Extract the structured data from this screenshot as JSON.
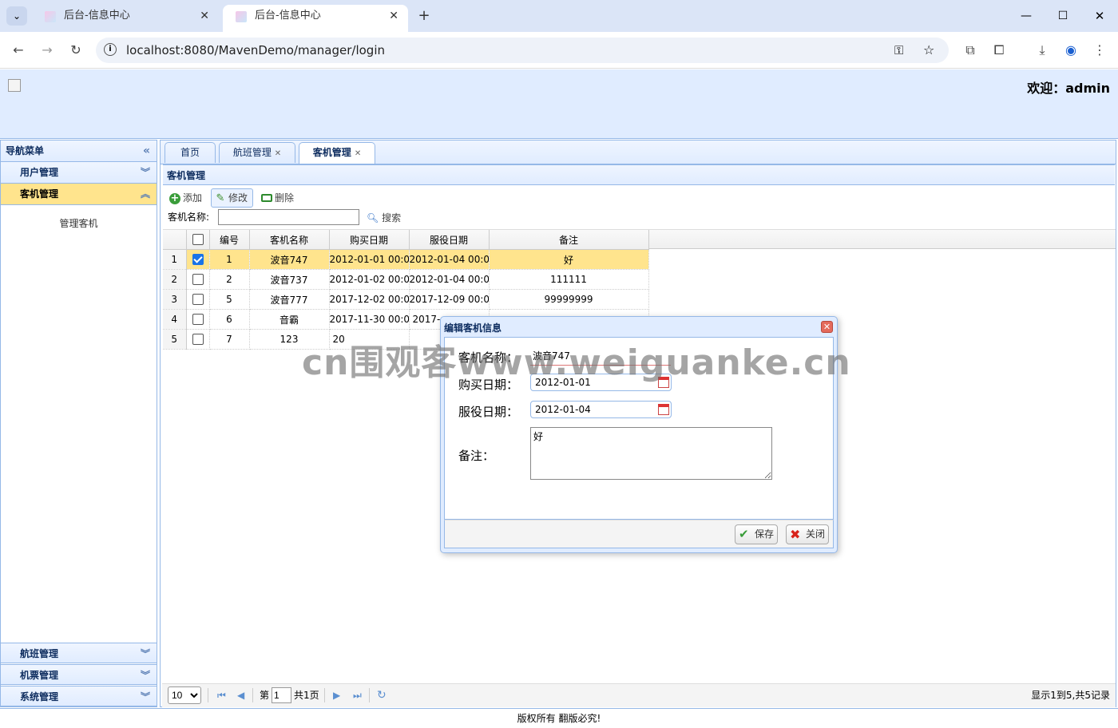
{
  "browser": {
    "tabs": [
      {
        "title": "后台-信息中心"
      },
      {
        "title": "后台-信息中心"
      }
    ],
    "url": "localhost:8080/MavenDemo/manager/login"
  },
  "header": {
    "welcome": "欢迎：admin"
  },
  "nav": {
    "title": "导航菜单",
    "sections": [
      {
        "label": "用户管理"
      },
      {
        "label": "客机管理",
        "items": [
          "管理客机"
        ]
      },
      {
        "label": "航班管理"
      },
      {
        "label": "机票管理"
      },
      {
        "label": "系统管理"
      }
    ]
  },
  "content_tabs": [
    {
      "label": "首页"
    },
    {
      "label": "航班管理"
    },
    {
      "label": "客机管理"
    }
  ],
  "panel": {
    "title": "客机管理",
    "toolbar": {
      "add": "添加",
      "edit": "修改",
      "delete": "删除"
    },
    "search": {
      "label": "客机名称:",
      "value": "",
      "button": "搜索"
    }
  },
  "grid": {
    "columns": [
      "编号",
      "客机名称",
      "购买日期",
      "服役日期",
      "备注"
    ],
    "rows": [
      {
        "rn": "1",
        "checked": true,
        "id": "1",
        "name": "波音747",
        "buy": "2012-01-01 00:0",
        "serve": "2012-01-04 00:0",
        "note": "好"
      },
      {
        "rn": "2",
        "checked": false,
        "id": "2",
        "name": "波音737",
        "buy": "2012-01-02 00:0",
        "serve": "2012-01-04 00:0",
        "note": "111111"
      },
      {
        "rn": "3",
        "checked": false,
        "id": "5",
        "name": "波音777",
        "buy": "2017-12-02 00:0",
        "serve": "2017-12-09 00:0",
        "note": "99999999"
      },
      {
        "rn": "4",
        "checked": false,
        "id": "6",
        "name": "音霸",
        "buy": "2017-11-30 00:0",
        "serve": "2017-",
        "note": ""
      },
      {
        "rn": "5",
        "checked": false,
        "id": "7",
        "name": "123",
        "buy": "20",
        "serve": "",
        "note": ""
      }
    ]
  },
  "pager": {
    "page_size": "10",
    "page_prefix": "第",
    "page_value": "1",
    "page_total": "共1页",
    "summary": "显示1到5,共5记录"
  },
  "dialog": {
    "title": "编辑客机信息",
    "fields": {
      "name_label": "客机名称：",
      "name_value": "波音747",
      "buy_label": "购买日期：",
      "buy_value": "2012-01-01",
      "serve_label": "服役日期：",
      "serve_value": "2012-01-04",
      "note_label": "备注：",
      "note_value": "好"
    },
    "save": "保存",
    "close": "关闭"
  },
  "footer": "版权所有 翻版必究!",
  "watermark": "cn围观客www.weiguanke.cn",
  "colors": {
    "accent": "#95b8e7",
    "selected_row": "#ffe48d",
    "header_bg": "#e0ecff"
  }
}
